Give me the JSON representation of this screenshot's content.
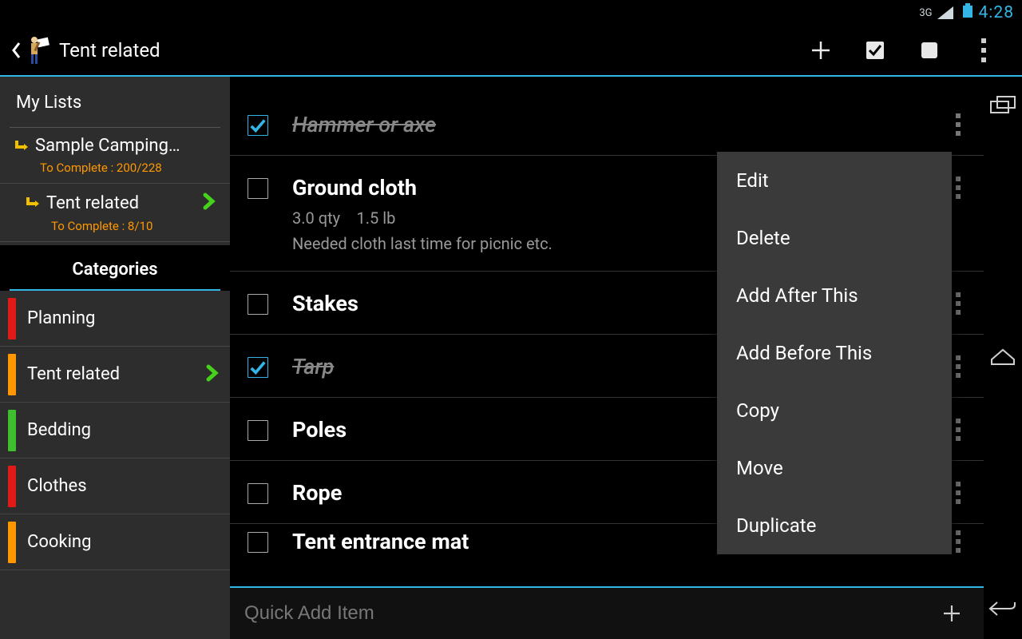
{
  "status": {
    "network": "3G",
    "time": "4:28"
  },
  "action_bar": {
    "title": "Tent related"
  },
  "sidebar": {
    "my_lists_label": "My Lists",
    "lists": [
      {
        "label": "Sample Camping…",
        "sub": "To Complete : 200/228",
        "selected": false
      },
      {
        "label": "Tent related",
        "sub": "To Complete : 8/10",
        "selected": true
      }
    ],
    "categories_label": "Categories",
    "categories": [
      {
        "label": "Planning",
        "color": "#e01919",
        "selected": false
      },
      {
        "label": "Tent related",
        "color": "#ff9800",
        "selected": true
      },
      {
        "label": "Bedding",
        "color": "#3fbf2f",
        "selected": false
      },
      {
        "label": "Clothes",
        "color": "#e01919",
        "selected": false
      },
      {
        "label": "Cooking",
        "color": "#ff9800",
        "selected": false
      }
    ]
  },
  "items": [
    {
      "title": "Hammer or axe",
      "checked": true,
      "qty": "",
      "weight": "",
      "note": ""
    },
    {
      "title": "Ground cloth",
      "checked": false,
      "qty": "3.0 qty",
      "weight": "1.5 lb",
      "note": "Needed cloth last time for picnic etc."
    },
    {
      "title": "Stakes",
      "checked": false,
      "qty": "",
      "weight": "",
      "note": ""
    },
    {
      "title": "Tarp",
      "checked": true,
      "qty": "",
      "weight": "",
      "note": ""
    },
    {
      "title": "Poles",
      "checked": false,
      "qty": "",
      "weight": "",
      "note": ""
    },
    {
      "title": "Rope",
      "checked": false,
      "qty": "",
      "weight": "",
      "note": ""
    },
    {
      "title": "Tent entrance mat",
      "checked": false,
      "qty": "",
      "weight": "",
      "note": ""
    }
  ],
  "context_menu": {
    "items": [
      "Edit",
      "Delete",
      "Add After This",
      "Add Before This",
      "Copy",
      "Move",
      "Duplicate"
    ]
  },
  "quick_add": {
    "placeholder": "Quick Add Item"
  }
}
